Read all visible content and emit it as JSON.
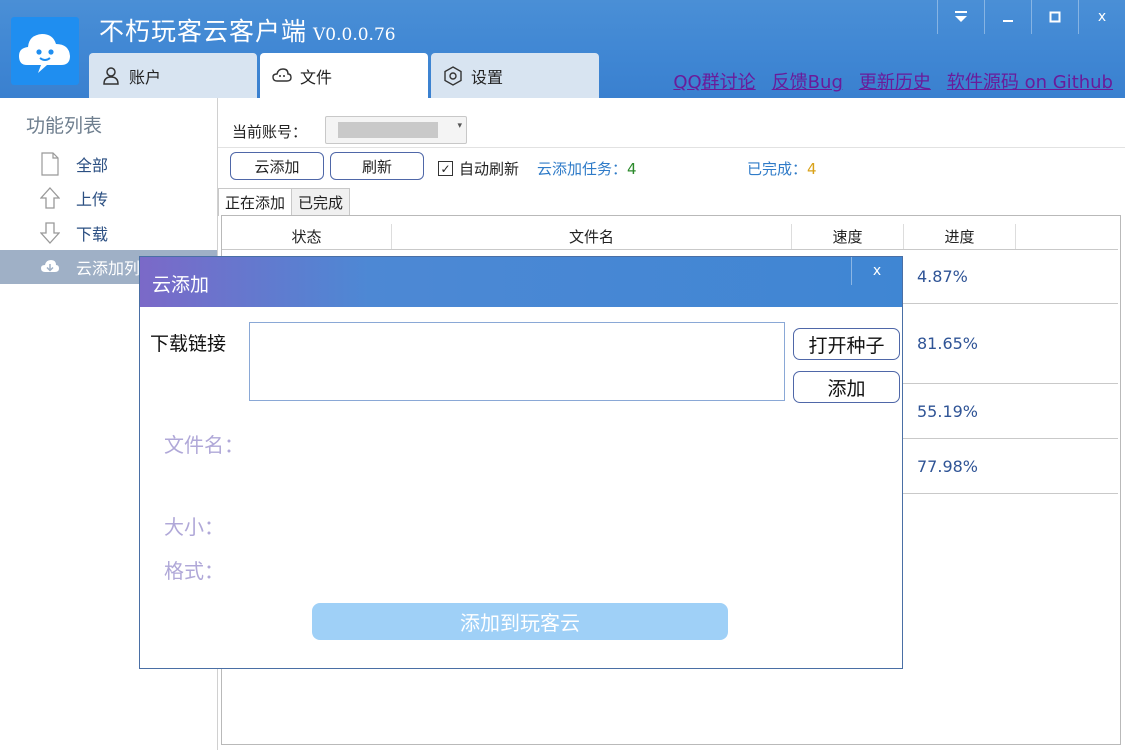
{
  "app": {
    "title": "不朽玩客云客户端",
    "version": "V0.0.0.76"
  },
  "window_buttons": [
    "▼",
    "–",
    "□",
    "x"
  ],
  "tabs": [
    {
      "label": "账户",
      "icon": "user-icon"
    },
    {
      "label": "文件",
      "icon": "cloud-icon"
    },
    {
      "label": "设置",
      "icon": "gear-icon"
    }
  ],
  "links": [
    {
      "label": "QQ群讨论"
    },
    {
      "label": "反馈Bug"
    },
    {
      "label": "更新历史"
    },
    {
      "label": "软件源码 on Github"
    }
  ],
  "sidebar": {
    "title": "功能列表",
    "items": [
      {
        "label": "全部",
        "icon": "file-icon"
      },
      {
        "label": "上传",
        "icon": "upload-arrow-icon"
      },
      {
        "label": "下载",
        "icon": "download-arrow-icon"
      },
      {
        "label": "云添加列表",
        "icon": "cloud-download-icon"
      }
    ]
  },
  "account": {
    "label": "当前账号："
  },
  "toolbar": {
    "cloud_add_label": "云添加",
    "refresh_label": "刷新",
    "auto_refresh_label": "自动刷新",
    "auto_refresh_checked": true,
    "tasks_label": "云添加任务：",
    "tasks_count": "4",
    "done_label": "已完成：",
    "done_count": "4"
  },
  "subtabs": [
    "正在添加",
    "已完成"
  ],
  "table": {
    "columns": [
      "状态",
      "文件名",
      "速度",
      "进度"
    ],
    "rows": [
      {
        "progress": "4.87%"
      },
      {
        "progress": "81.65%"
      },
      {
        "progress": "55.19%"
      },
      {
        "progress": "77.98%"
      }
    ]
  },
  "dialog": {
    "title": "云添加",
    "close_label": "x",
    "link_label": "下载链接",
    "link_value": "",
    "open_torrent_label": "打开种子",
    "add_label": "添加",
    "filename_label": "文件名：",
    "size_label": "大小：",
    "format_label": "格式：",
    "submit_label": "添加到玩客云"
  }
}
